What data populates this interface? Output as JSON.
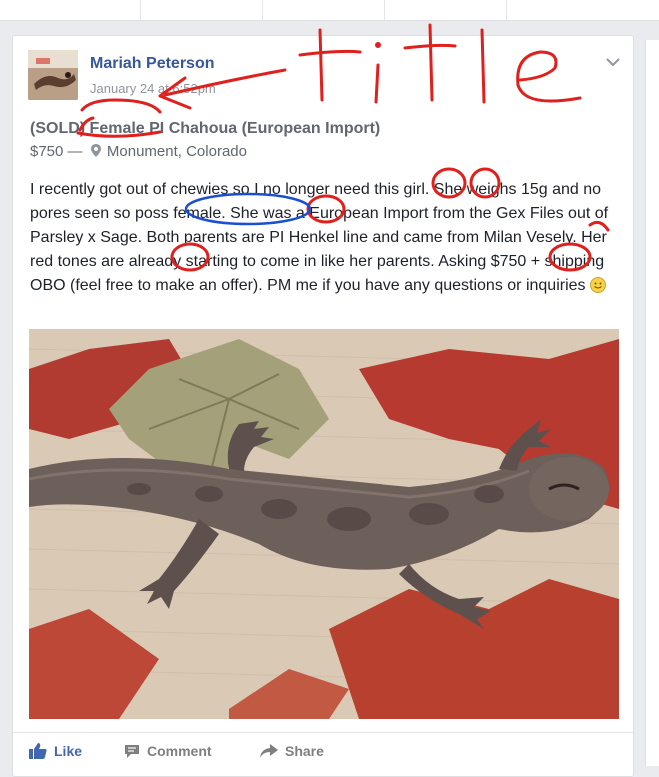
{
  "post": {
    "author": "Mariah Peterson",
    "timestamp": "January 24 at 6:52pm",
    "title": "(SOLD) Female PI Chahoua (European Import)",
    "price": "$750",
    "price_separator": "—",
    "location": "Monument, Colorado",
    "body": "I recently got out of chewies so I no longer need this girl. She weighs 15g and no pores seen so poss female. She was a European Import from the Gex Files out of Parsley x Sage. Both parents are PI Henkel line and came from Milan Vesely. Her red tones are already starting to come in like her parents. Asking $750 + shipping OBO (feel free to make an offer). PM me if you have any questions or inquiries"
  },
  "actions": {
    "like": "Like",
    "comment": "Comment",
    "share": "Share"
  },
  "annotation": {
    "handwritten_word": "title"
  },
  "icons": {
    "post_menu": "chevron-down-icon",
    "location": "map-pin-icon",
    "emoji": "smiley-icon",
    "like": "thumbs-up-icon",
    "comment": "comment-bubble-icon",
    "share": "share-arrow-icon"
  },
  "colors": {
    "author_link": "#365899",
    "like_active": "#4267b2",
    "annotation_red": "#e0201c",
    "annotation_blue": "#1b4fcf"
  }
}
